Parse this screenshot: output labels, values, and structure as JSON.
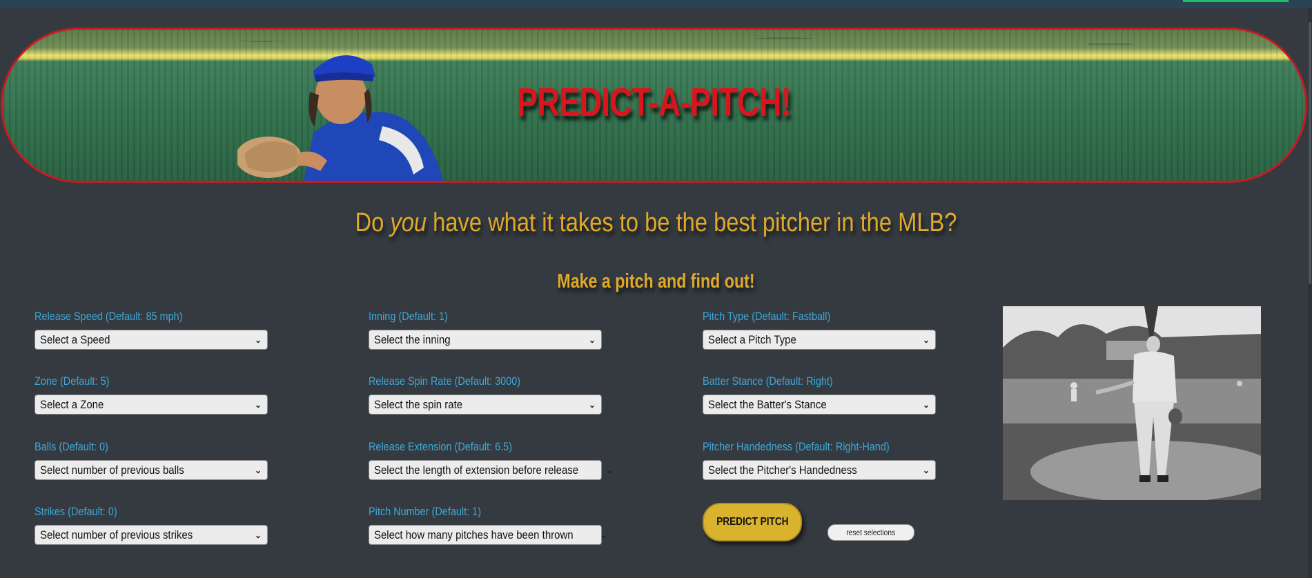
{
  "hero": {
    "title": "PREDICT-A-PITCH!"
  },
  "headline": {
    "before": "Do ",
    "emphasis": "you",
    "after": " have what it takes to be the best pitcher in the MLB?"
  },
  "subhead": "Make a pitch and find out!",
  "form": {
    "release_speed": {
      "label": "Release Speed (Default: 85 mph)",
      "value": "Select a Speed"
    },
    "zone": {
      "label": "Zone (Default: 5)",
      "value": "Select a Zone"
    },
    "balls": {
      "label": "Balls (Default: 0)",
      "value": "Select number of previous balls"
    },
    "strikes": {
      "label": "Strikes (Default: 0)",
      "value": "Select number of previous strikes"
    },
    "inning": {
      "label": "Inning (Default: 1)",
      "value": "Select the inning"
    },
    "spin_rate": {
      "label": "Release Spin Rate (Default: 3000)",
      "value": "Select the spin rate"
    },
    "extension": {
      "label": "Release Extension (Default: 6.5)",
      "value": "Select the length of extension before release"
    },
    "pitch_number": {
      "label": "Pitch Number (Default: 1)",
      "value": "Select how many pitches have been thrown"
    },
    "pitch_type": {
      "label": "Pitch Type (Default: Fastball)",
      "value": "Select a Pitch Type"
    },
    "batter_stance": {
      "label": "Batter Stance (Default: Right)",
      "value": "Select the Batter's Stance"
    },
    "pitcher_hand": {
      "label": "Pitcher Handedness (Default: Right-Hand)",
      "value": "Select the Pitcher's Handedness"
    }
  },
  "buttons": {
    "predict": "PREDICT PITCH",
    "reset": "reset selections"
  },
  "colors": {
    "background": "#343a40",
    "accent_gold": "#e0a92a",
    "title_red": "#d9161e",
    "label_blue": "#3ea8d8",
    "button_gold": "#d9b22e"
  },
  "icons": {
    "select_chevron": "chevron-down-icon"
  }
}
